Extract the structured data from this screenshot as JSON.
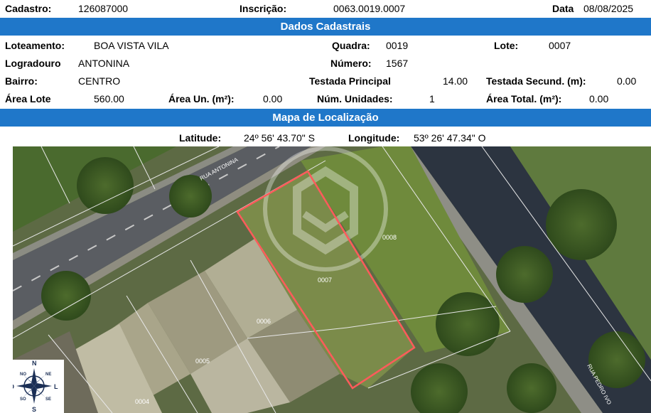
{
  "header": {
    "cadastro_label": "Cadastro:",
    "cadastro_value": "126087000",
    "inscricao_label": "Inscrição:",
    "inscricao_value": "0063.0019.0007",
    "data_label": "Data",
    "data_value": "08/08/2025"
  },
  "section_dados": {
    "title": "Dados Cadastrais"
  },
  "dados": {
    "loteamento_label": "Loteamento:",
    "loteamento_value": "BOA VISTA VILA",
    "quadra_label": "Quadra:",
    "quadra_value": "0019",
    "lote_label": "Lote:",
    "lote_value": "0007",
    "logradouro_label": "Logradouro",
    "logradouro_value": "ANTONINA",
    "numero_label": "Número:",
    "numero_value": "1567",
    "bairro_label": "Bairro:",
    "bairro_value": "CENTRO",
    "testada_principal_label": "Testada Principal",
    "testada_principal_value": "14.00",
    "testada_secund_label": "Testada Secund. (m):",
    "testada_secund_value": "0.00",
    "area_lote_label": "Área Lote",
    "area_lote_value": "560.00",
    "area_un_label": "Área Un. (m²):",
    "area_un_value": "0.00",
    "num_unidades_label": "Núm. Unidades:",
    "num_unidades_value": "1",
    "area_total_label": "Área Total. (m²):",
    "area_total_value": "0.00"
  },
  "section_mapa": {
    "title": "Mapa de Localização"
  },
  "location": {
    "latitude_label": "Latitude:",
    "latitude_value": "24º 56' 43.70\" S",
    "longitude_label": "Longitude:",
    "longitude_value": "53º 26' 47.34\" O"
  },
  "map": {
    "street_top": "RUA ANTONINA",
    "street_right": "RUA PEDRO IVO",
    "lots": [
      "0008",
      "0007",
      "0006",
      "0005",
      "0004"
    ],
    "highlight_color": "#ff5b5b",
    "compass": {
      "n": "N",
      "s": "S",
      "l": "L",
      "o": "O",
      "ne": "NE",
      "no": "NO",
      "se": "SE",
      "so": "SO"
    }
  }
}
